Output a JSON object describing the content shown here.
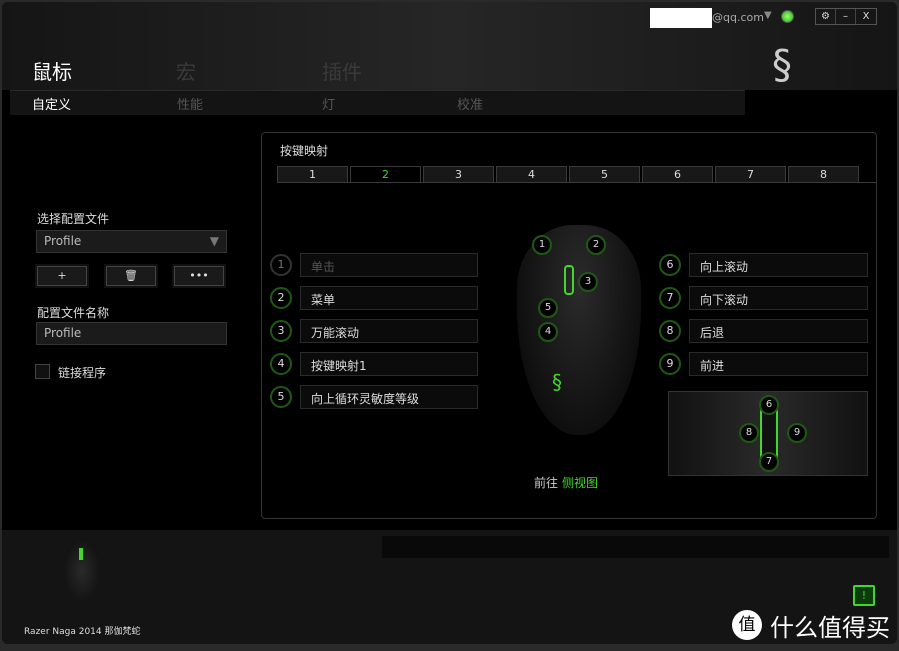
{
  "header": {
    "email": "@qq.com",
    "main_tabs": [
      "鼠标",
      "宏",
      "插件"
    ],
    "sub_tabs": [
      "自定义",
      "性能",
      "灯",
      "校准"
    ],
    "window_buttons": [
      "⚙",
      "–",
      "X"
    ]
  },
  "left": {
    "profile_label": "选择配置文件",
    "profile_value": "Profile",
    "add": "+",
    "delete": "🗑",
    "more": "•••",
    "name_label": "配置文件名称",
    "name_value": "Profile",
    "link_label": "链接程序"
  },
  "mapping": {
    "title": "按键映射",
    "tabs": [
      "1",
      "2",
      "3",
      "4",
      "5",
      "6",
      "7",
      "8"
    ],
    "active_tab": "2",
    "left_buttons": [
      {
        "n": "1",
        "label": "单击"
      },
      {
        "n": "2",
        "label": "菜单"
      },
      {
        "n": "3",
        "label": "万能滚动"
      },
      {
        "n": "4",
        "label": "按键映射1"
      },
      {
        "n": "5",
        "label": "向上循环灵敏度等级"
      }
    ],
    "right_buttons": [
      {
        "n": "6",
        "label": "向上滚动"
      },
      {
        "n": "7",
        "label": "向下滚动"
      },
      {
        "n": "8",
        "label": "后退"
      },
      {
        "n": "9",
        "label": "前进"
      }
    ],
    "goto_prefix": "前往",
    "goto_link": "侧视图"
  },
  "footer": {
    "device": "Razer Naga 2014 那伽梵蛇",
    "alert": "!",
    "watermark": "什么值得买",
    "watermark_badge": "值"
  },
  "colors": {
    "accent": "#44d62c"
  }
}
